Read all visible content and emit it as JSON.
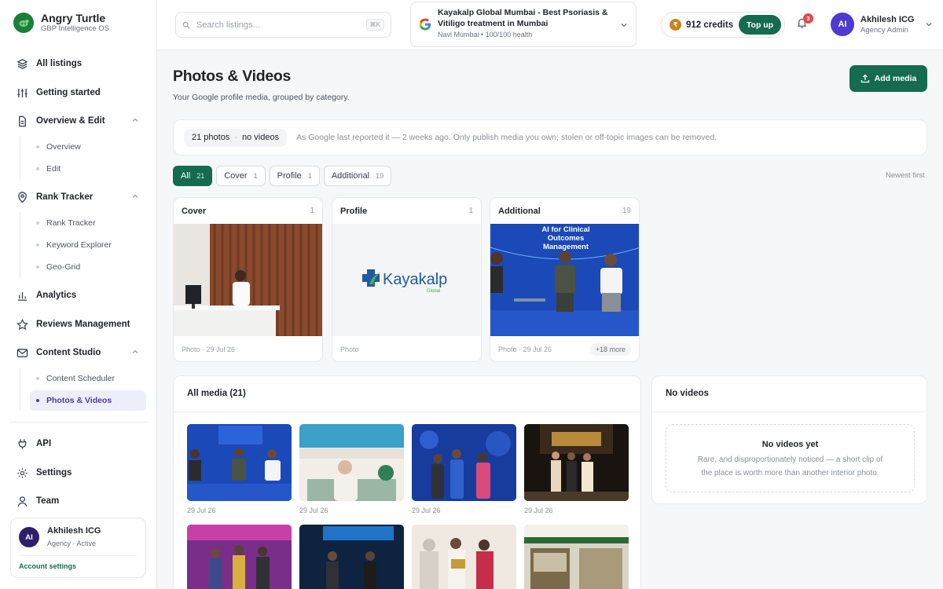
{
  "brand": {
    "name": "Angry Turtle",
    "tagline": "GBP Intelligence OS"
  },
  "sidebar": {
    "items": [
      {
        "label": "All listings",
        "icon": "layers-icon"
      },
      {
        "label": "Getting started",
        "icon": "sliders-icon"
      },
      {
        "label": "Overview & Edit",
        "icon": "document-icon",
        "expanded": true,
        "children": [
          "Overview",
          "Edit"
        ]
      },
      {
        "label": "Rank Tracker",
        "icon": "map-pin-icon",
        "expanded": true,
        "children": [
          "Rank Tracker",
          "Keyword Explorer",
          "Geo-Grid"
        ]
      },
      {
        "label": "Analytics",
        "icon": "bar-chart-icon"
      },
      {
        "label": "Reviews Management",
        "icon": "star-icon"
      },
      {
        "label": "Content Studio",
        "icon": "mail-icon",
        "expanded": true,
        "children": [
          "Content Scheduler",
          "Photos & Videos"
        ],
        "active_child": "Photos & Videos"
      },
      {
        "label": "API",
        "icon": "plug-icon"
      },
      {
        "label": "Settings",
        "icon": "gear-icon"
      },
      {
        "label": "Team",
        "icon": "user-icon"
      }
    ],
    "account": {
      "initials": "AI",
      "name": "Akhilesh ICG",
      "status": "Agency · Active",
      "link": "Account settings"
    }
  },
  "topbar": {
    "search_placeholder": "Search listings...",
    "search_shortcut": "⌘K",
    "listing": {
      "title": "Kayakalp Global Mumbai - Best Psoriasis & Vitiligo treatment in Mumbai",
      "sub": "Navi Mumbai • 100/100 health"
    },
    "credits": {
      "currency_icon": "₹",
      "value": "912 credits",
      "topup_label": "Top up"
    },
    "notifications": {
      "count": "3"
    },
    "user": {
      "initials": "AI",
      "name": "Akhilesh ICG",
      "role": "Agency Admin"
    }
  },
  "page": {
    "title": "Photos & Videos",
    "subtitle": "Your Google profile media, grouped by category.",
    "add_button": "Add media",
    "summary": {
      "photos": "21 photos",
      "separator": "·",
      "videos": "no videos",
      "note": "As Google last reported it — 2 weeks ago. Only publish media you own; stolen or off-topic images can be removed."
    },
    "filters": [
      {
        "label": "All",
        "count": "21",
        "active": true
      },
      {
        "label": "Cover",
        "count": "1"
      },
      {
        "label": "Profile",
        "count": "1"
      },
      {
        "label": "Additional",
        "count": "19"
      }
    ],
    "sort_label": "Newest first",
    "categories": [
      {
        "name": "Cover",
        "count": "1",
        "foot": "Photo · 29 Jul 26"
      },
      {
        "name": "Profile",
        "count": "1",
        "foot": "Photo",
        "logo_text": "Kayakalp",
        "logo_sub": "Global"
      },
      {
        "name": "Additional",
        "count": "19",
        "foot": "Photo · 29 Jul 26",
        "more": "+18 more",
        "banner": "AI for Clinical Outcomes Management"
      }
    ],
    "all_media": {
      "title": "All media (21)",
      "thumbs": [
        {
          "date": "29 Jul 26"
        },
        {
          "date": "29 Jul 26"
        },
        {
          "date": "29 Jul 26"
        },
        {
          "date": "29 Jul 26"
        },
        {
          "date": ""
        },
        {
          "date": ""
        },
        {
          "date": ""
        },
        {
          "date": ""
        }
      ]
    },
    "videos": {
      "title": "No videos",
      "empty_title": "No videos yet",
      "empty_text": "Rare, and disproportionately noticed — a short clip of the place is worth more than another interior photo."
    }
  }
}
